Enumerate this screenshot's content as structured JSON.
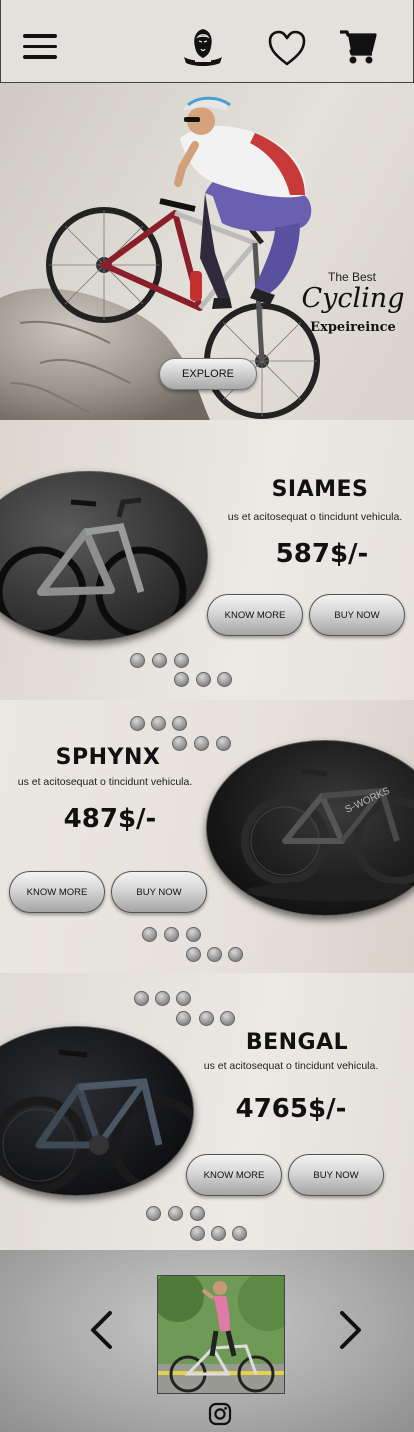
{
  "header": {
    "menu_icon": "hamburger-menu-icon",
    "logo_icon": "lion-crest-logo-icon",
    "wishlist_icon": "heart-icon",
    "cart_icon": "shopping-cart-icon"
  },
  "hero": {
    "line1": "The Best",
    "line2": "Cycling",
    "line3": "Expeireince",
    "button_label": "EXPLORE"
  },
  "products": [
    {
      "name": "SIAMES",
      "description": "us et acitosequat o tincidunt vehicula.",
      "price": "587$/-",
      "know_more_label": "KNOW MORE",
      "buy_now_label": "BUY NOW"
    },
    {
      "name": "SPHYNX",
      "description": "us et acitosequat o tincidunt vehicula.",
      "price": "487$/-",
      "know_more_label": "KNOW MORE",
      "buy_now_label": "BUY NOW"
    },
    {
      "name": "BENGAL",
      "description": "us et acitosequat o tincidunt vehicula.",
      "price": "4765$/-",
      "know_more_label": "KNOW MORE",
      "buy_now_label": "BUY NOW"
    }
  ],
  "footer": {
    "prev_icon": "chevron-left-icon",
    "next_icon": "chevron-right-icon",
    "social_icon": "instagram-icon"
  },
  "colors": {
    "text": "#111111",
    "button_top": "#f3f3f3",
    "button_bottom": "#a5a5a5",
    "dot": "#8a8a8a",
    "footer_bg": "#a8a8a8"
  }
}
